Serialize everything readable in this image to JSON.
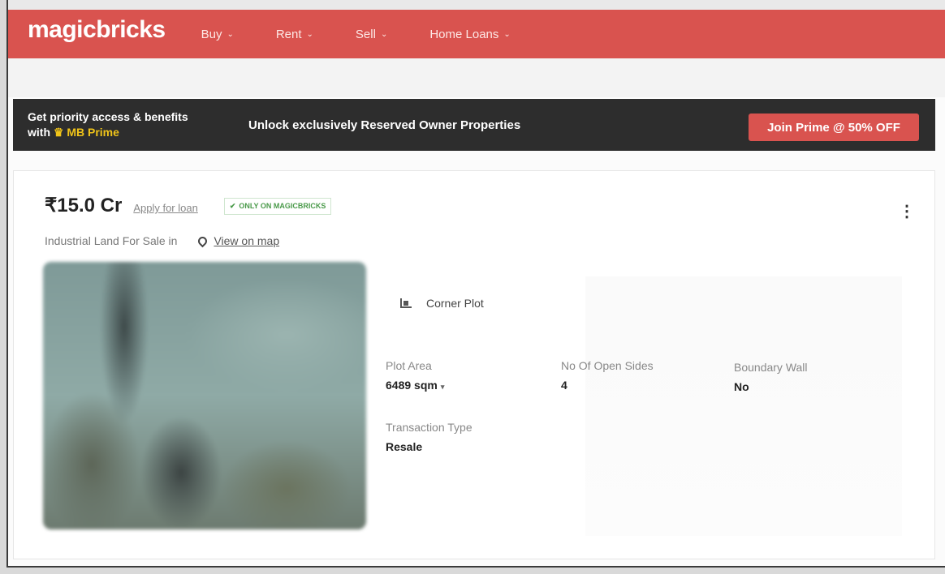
{
  "header": {
    "logo": "magicbricks",
    "nav": [
      {
        "label": "Buy",
        "chevron": "⌄"
      },
      {
        "label": "Rent",
        "chevron": "⌄"
      },
      {
        "label": "Sell",
        "chevron": "⌄"
      },
      {
        "label": "Home Loans",
        "chevron": "⌄"
      }
    ]
  },
  "prime_banner": {
    "line1": "Get priority access & benefits",
    "line2_prefix": "with",
    "crown_icon": "♛",
    "brand": "MB Prime",
    "message": "Unlock exclusively Reserved Owner Properties",
    "cta": "Join Prime @ 50% OFF"
  },
  "listing": {
    "price": "₹15.0 Cr",
    "apply_loan": "Apply for loan",
    "badge_tick": "✔",
    "badge": "ONLY ON MAGICBRICKS",
    "subtitle": "Industrial Land For Sale in",
    "view_map": "View on map",
    "more_icon": "⋮",
    "feature": "Corner Plot",
    "attributes": {
      "plot_area": {
        "label": "Plot Area",
        "value": "6489 sqm",
        "caret": "▾"
      },
      "open_sides": {
        "label": "No Of Open Sides",
        "value": "4"
      },
      "boundary_wall": {
        "label": "Boundary Wall",
        "value": "No"
      },
      "transaction": {
        "label": "Transaction Type",
        "value": "Resale"
      }
    }
  },
  "colors": {
    "brand_red": "#d9534f",
    "banner_dark": "#2d2d2d",
    "prime_gold": "#f0c419",
    "badge_green": "#4a9a4a"
  }
}
